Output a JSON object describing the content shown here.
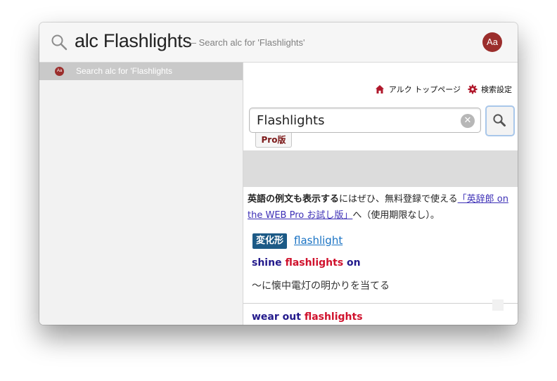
{
  "spotlight": {
    "query": "alc Flashlights",
    "subtitle": "— Search alc for 'Flashlights'",
    "app_icon_label": "Aa"
  },
  "results": [
    {
      "icon_label": "Aa",
      "label": "Search alc for 'Flashlights"
    }
  ],
  "preview": {
    "top_links": {
      "home": "アルク トップページ",
      "settings": "検索設定"
    },
    "search_value": "Flashlights",
    "clear_glyph": "✕",
    "pro_tab": "Pro版",
    "promo": {
      "bold": "英語の例文も表示する",
      "text": "にはぜひ、無料登録で使える",
      "link": "「英辞郎 on the WEB Pro お試し版」",
      "tail": "へ（使用期限なし）。"
    },
    "henka_badge": "変化形",
    "henka_link": "flashlight",
    "entry1": {
      "pre": "shine ",
      "hl": "flashlights",
      "post": " on"
    },
    "def1": "〜に懐中電灯の明かりを当てる",
    "entry2": {
      "pre": "wear out ",
      "hl": "flashlights"
    }
  },
  "colors": {
    "brand_red": "#9b2e2c",
    "entry_blue": "#231a8c",
    "highlight_red": "#d0122d",
    "badge_blue": "#1c5a86"
  },
  "icons": [
    "search-icon",
    "app-icon",
    "home-icon",
    "gear-icon",
    "clear-icon",
    "magnifier-icon"
  ]
}
